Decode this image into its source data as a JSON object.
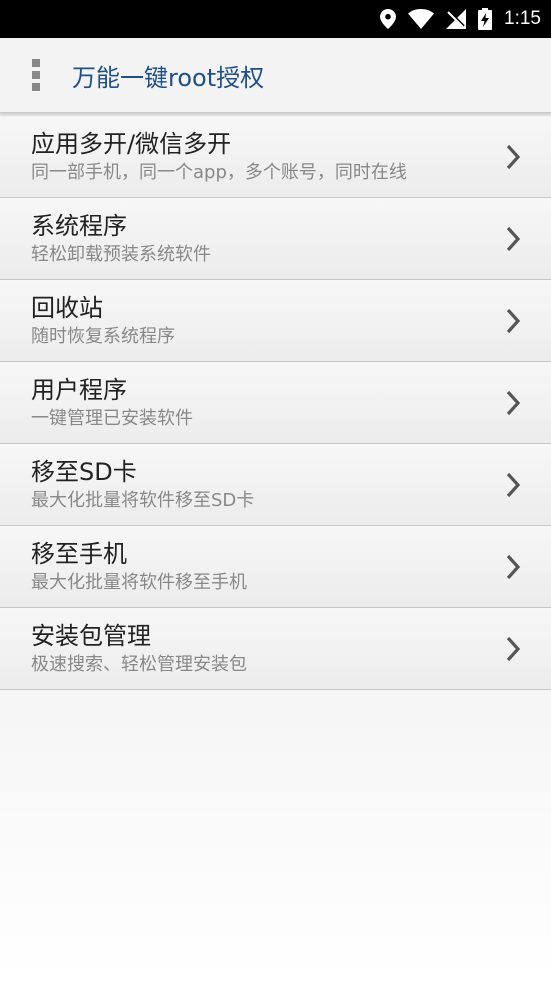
{
  "status": {
    "time": "1:15"
  },
  "header": {
    "title": "万能一键root授权",
    "menu_icon": "more-vert-icon"
  },
  "items": [
    {
      "title": "应用多开/微信多开",
      "subtitle": "同一部手机，同一个app，多个账号，同时在线"
    },
    {
      "title": "系统程序",
      "subtitle": "轻松卸载预装系统软件"
    },
    {
      "title": "回收站",
      "subtitle": "随时恢复系统程序"
    },
    {
      "title": "用户程序",
      "subtitle": "一键管理已安装软件"
    },
    {
      "title": "移至SD卡",
      "subtitle": "最大化批量将软件移至SD卡"
    },
    {
      "title": "移至手机",
      "subtitle": "最大化批量将软件移至手机"
    },
    {
      "title": "安装包管理",
      "subtitle": "极速搜索、轻松管理安装包"
    }
  ],
  "colors": {
    "title": "#1f4f86",
    "status_bar": "#000000"
  }
}
